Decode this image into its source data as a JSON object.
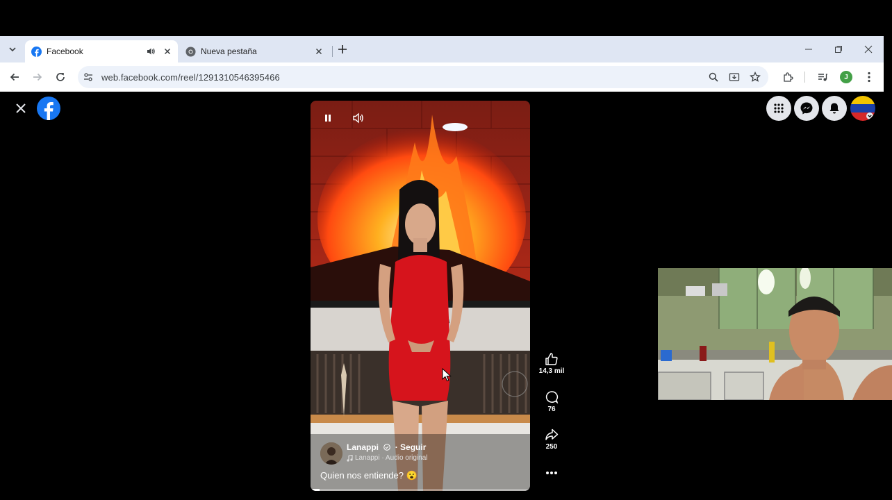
{
  "browser": {
    "tabs": [
      {
        "title": "Facebook",
        "active": true,
        "audio": true
      },
      {
        "title": "Nueva pestaña",
        "active": false
      }
    ],
    "url": "web.facebook.com/reel/1291310546395466",
    "profile_initial": "J"
  },
  "reel": {
    "author": "Lanappi",
    "follow_label": "· Seguir",
    "audio_label": "Lanappi · Audio original",
    "caption": "Quien nos entiende? 😮",
    "progress": 0.04
  },
  "actions": {
    "likes": "14,3 mil",
    "comments": "76",
    "shares": "250"
  },
  "colors": {
    "facebook_blue": "#1877f2",
    "tab_strip": "#dfe6f3",
    "omnibox": "#edf2fa"
  }
}
